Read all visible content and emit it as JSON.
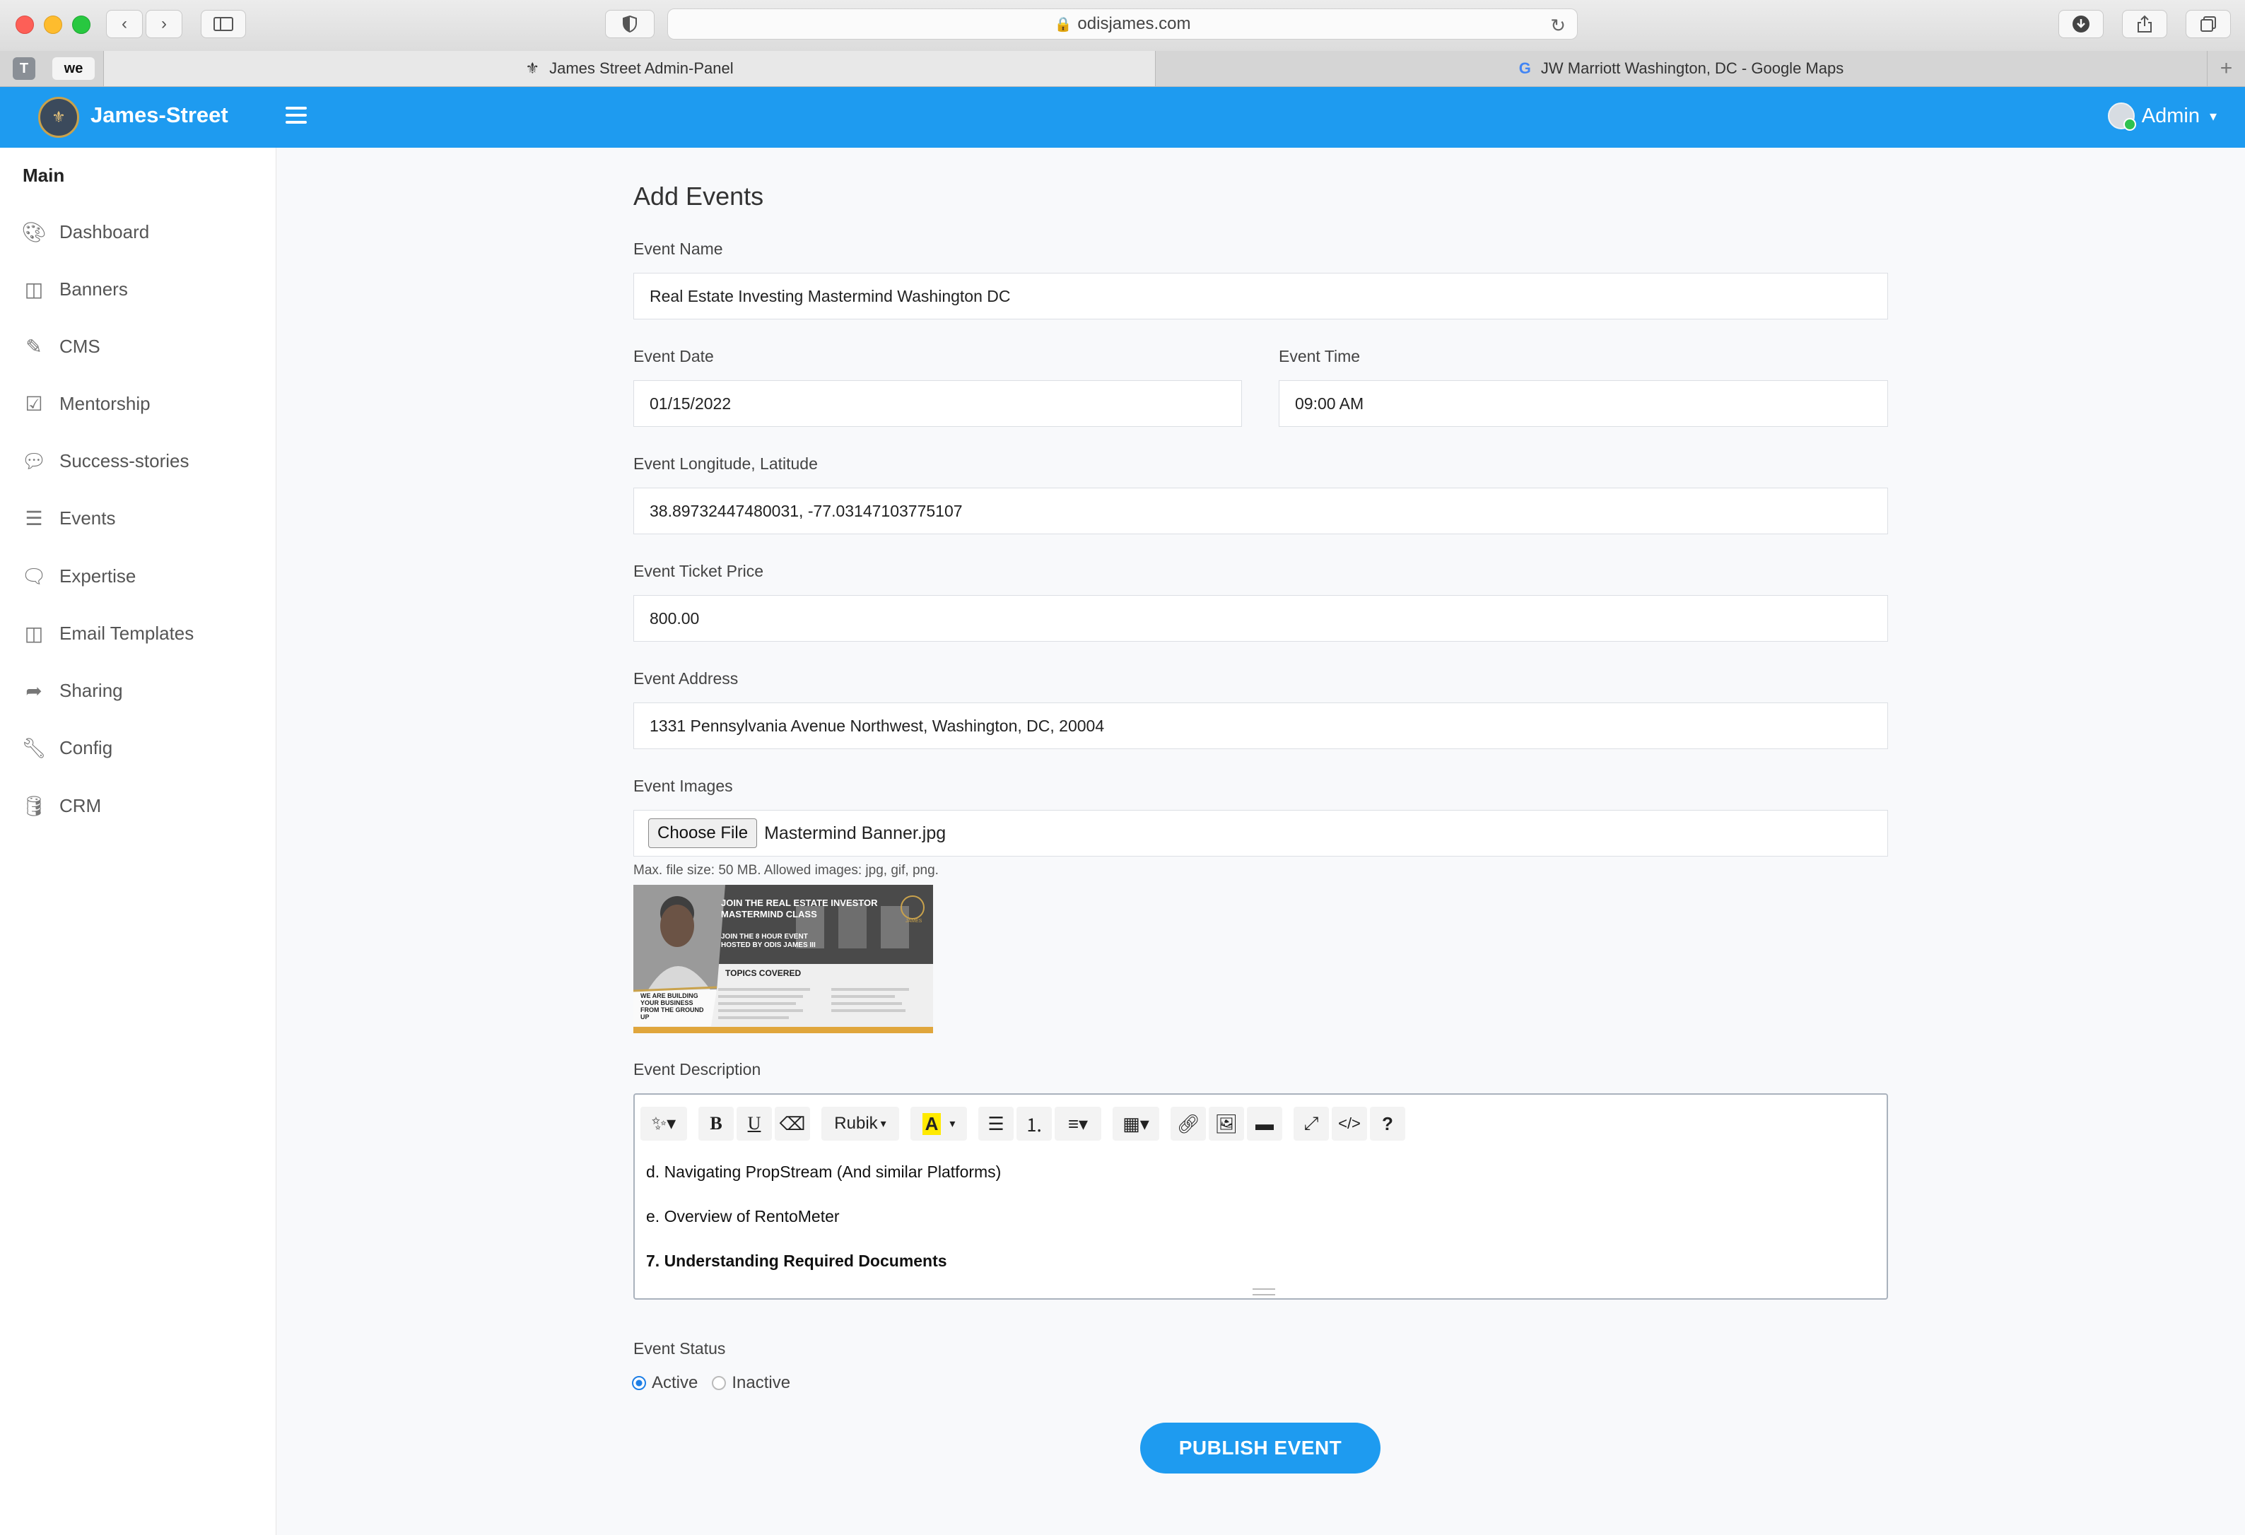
{
  "browser": {
    "url": "odisjames.com",
    "tabs": [
      {
        "title": "James Street Admin-Panel",
        "active": true
      },
      {
        "title": "JW Marriott Washington, DC - Google Maps",
        "active": false
      }
    ],
    "pinned": [
      "T",
      "we"
    ]
  },
  "header": {
    "brand": "James-Street",
    "user": "Admin",
    "accent": "#1e9bf0"
  },
  "sidebar": {
    "section": "Main",
    "items": [
      {
        "label": "Dashboard",
        "icon": "palette-icon"
      },
      {
        "label": "Banners",
        "icon": "columns-icon"
      },
      {
        "label": "CMS",
        "icon": "edit-icon"
      },
      {
        "label": "Mentorship",
        "icon": "calendar-check-icon"
      },
      {
        "label": "Success-stories",
        "icon": "comments-icon"
      },
      {
        "label": "Events",
        "icon": "list-icon"
      },
      {
        "label": "Expertise",
        "icon": "comment-icon"
      },
      {
        "label": "Email Templates",
        "icon": "columns-icon"
      },
      {
        "label": "Sharing",
        "icon": "share-icon"
      },
      {
        "label": "Config",
        "icon": "wrench-icon"
      },
      {
        "label": "CRM",
        "icon": "database-icon"
      }
    ]
  },
  "form": {
    "title": "Add Events",
    "event_name": {
      "label": "Event Name",
      "value": "Real Estate Investing Mastermind Washington DC"
    },
    "event_date": {
      "label": "Event Date",
      "value": "01/15/2022"
    },
    "event_time": {
      "label": "Event Time",
      "value": "09:00 AM"
    },
    "coords": {
      "label": "Event Longitude, Latitude",
      "value": "38.89732447480031, -77.03147103775107"
    },
    "price": {
      "label": "Event Ticket Price",
      "value": "800.00"
    },
    "address": {
      "label": "Event Address",
      "value": "1331 Pennsylvania Avenue Northwest, Washington, DC, 20004"
    },
    "images": {
      "label": "Event Images",
      "button": "Choose File",
      "file": "Mastermind Banner.jpg",
      "hint": "Max. file size: 50 MB. Allowed images: jpg, gif, png."
    },
    "banner": {
      "line1": "JOIN THE REAL ESTATE INVESTOR",
      "line2": "MASTERMIND CLASS",
      "line3": "JOIN THE 8 HOUR EVENT",
      "line4": "HOSTED BY ODIS JAMES III",
      "topics": "TOPICS COVERED",
      "tagline": "WE ARE BUILDING YOUR BUSINESS FROM THE GROUND UP",
      "brand": "JAMES"
    },
    "description": {
      "label": "Event Description",
      "font": "Rubik",
      "lines": [
        "d. Navigating PropStream (And similar Platforms)",
        "e. Overview of RentoMeter",
        "7. Understanding Required Documents"
      ]
    },
    "status": {
      "label": "Event Status",
      "options": [
        "Active",
        "Inactive"
      ],
      "selected": "Active"
    },
    "submit": "PUBLISH EVENT"
  }
}
